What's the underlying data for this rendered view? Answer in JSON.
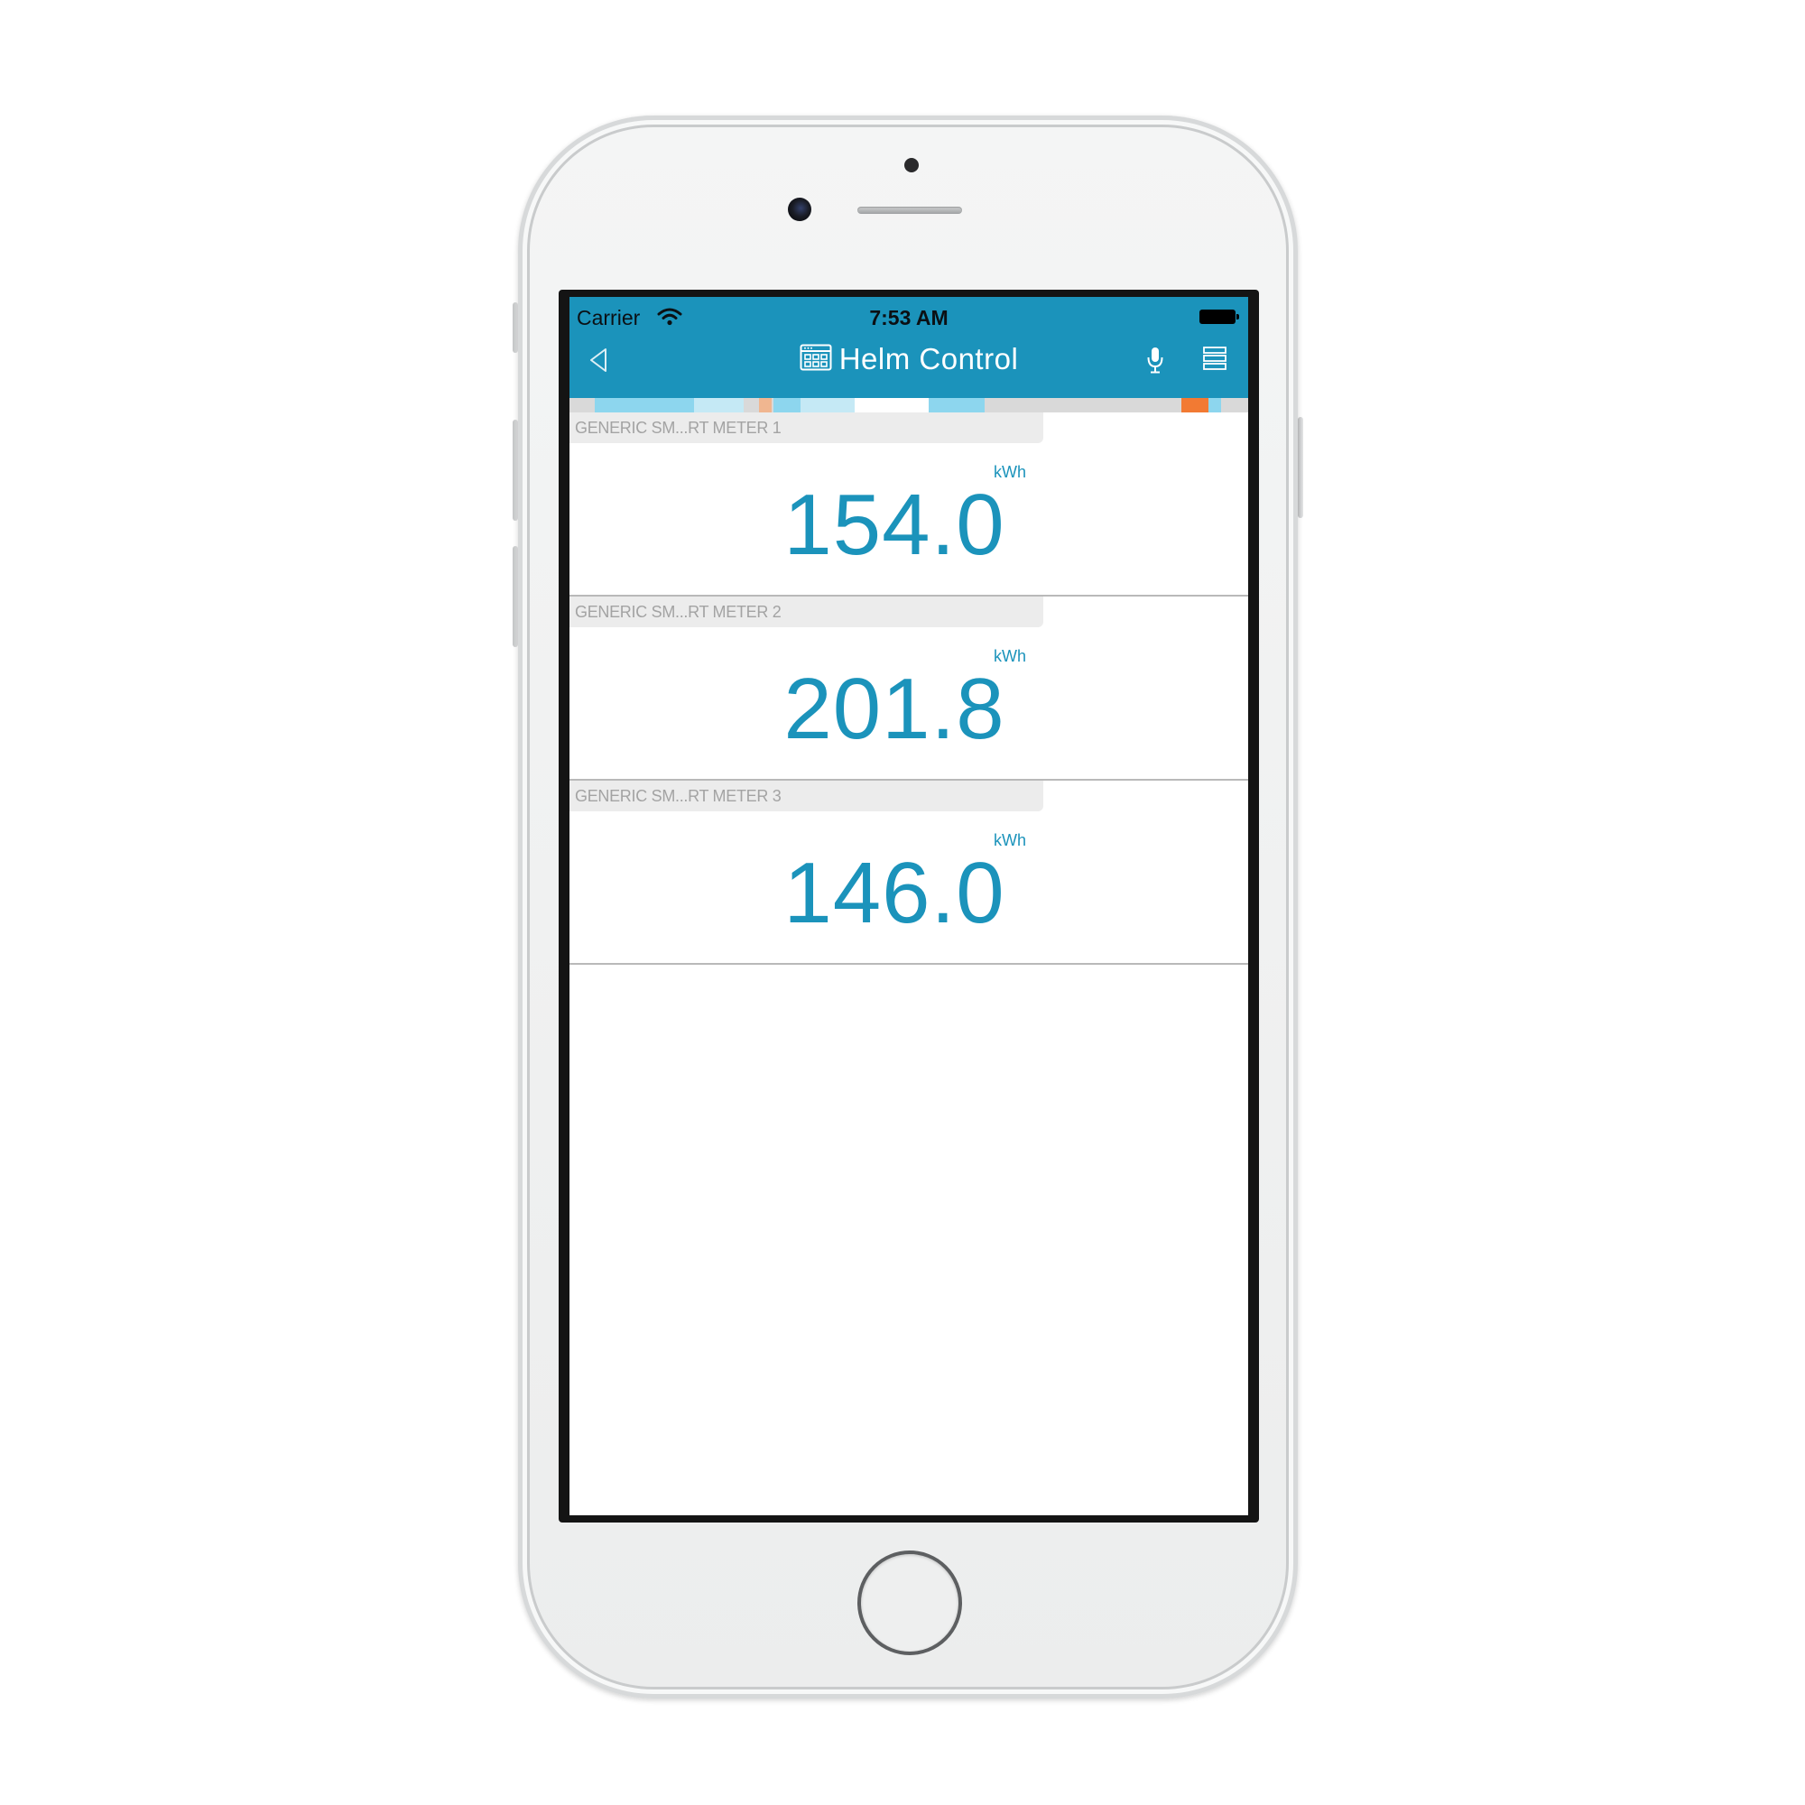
{
  "status_bar": {
    "carrier": "Carrier",
    "time": "7:53 AM",
    "wifi_icon": "wifi-icon",
    "battery_icon": "battery-icon"
  },
  "header": {
    "title": "Helm Control",
    "title_icon": "dashboard-icon",
    "back_icon": "back-arrow-icon",
    "mic_icon": "microphone-icon",
    "menu_icon": "list-menu-icon",
    "color": "#1b93bb"
  },
  "status_strip": {
    "colors": [
      "#d9d9d9",
      "#8dd6ee",
      "#c5e9f5",
      "#f0b690",
      "#8dd6ee",
      "#c5e9f5",
      "#ffffff",
      "#8dd6ee",
      "#f27a33"
    ]
  },
  "meters": [
    {
      "label": "GENERIC SM...RT METER 1",
      "value": "154.0",
      "unit": "kWh"
    },
    {
      "label": "GENERIC SM...RT METER 2",
      "value": "201.8",
      "unit": "kWh"
    },
    {
      "label": "GENERIC SM...RT METER 3",
      "value": "146.0",
      "unit": "kWh"
    }
  ]
}
